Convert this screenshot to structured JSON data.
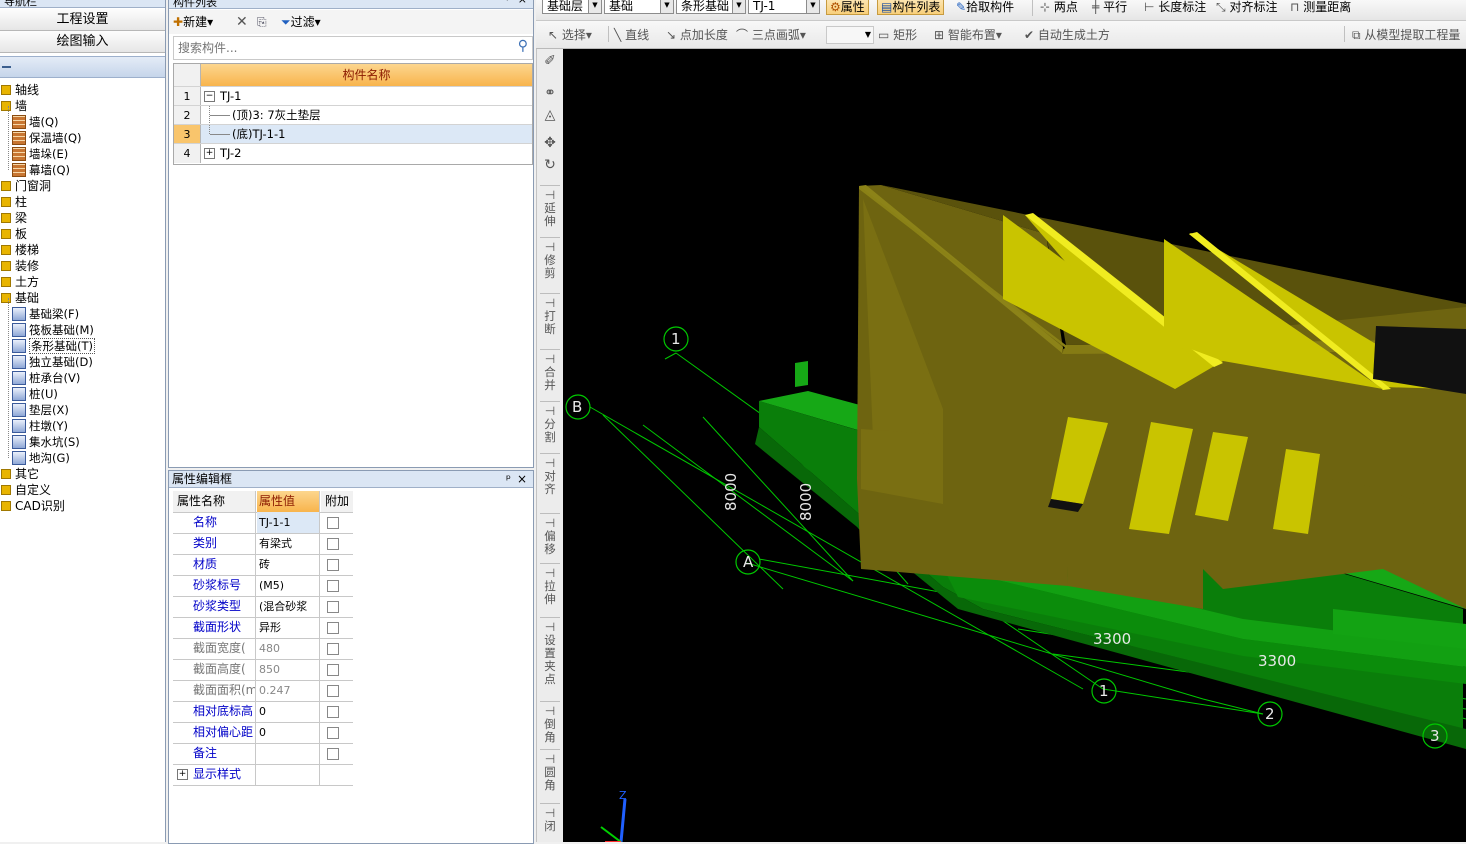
{
  "nav": {
    "title": "导航栏",
    "pin": "ᵖ",
    "close": "×",
    "buttons": [
      "工程设置",
      "绘图输入"
    ],
    "tree": [
      {
        "label": "轴线",
        "type": "folder"
      },
      {
        "label": "墙",
        "type": "folder-open"
      },
      {
        "label": "墙(Q)",
        "type": "child"
      },
      {
        "label": "保温墙(Q)",
        "type": "child"
      },
      {
        "label": "墙垛(E)",
        "type": "child"
      },
      {
        "label": "幕墙(Q)",
        "type": "child"
      },
      {
        "label": "门窗洞",
        "type": "folder"
      },
      {
        "label": "柱",
        "type": "folder"
      },
      {
        "label": "梁",
        "type": "folder"
      },
      {
        "label": "板",
        "type": "folder"
      },
      {
        "label": "楼梯",
        "type": "folder"
      },
      {
        "label": "装修",
        "type": "folder"
      },
      {
        "label": "土方",
        "type": "folder"
      },
      {
        "label": "基础",
        "type": "folder-open"
      },
      {
        "label": "基础梁(F)",
        "type": "child"
      },
      {
        "label": "筏板基础(M)",
        "type": "child"
      },
      {
        "label": "条形基础(T)",
        "type": "child-selected"
      },
      {
        "label": "独立基础(D)",
        "type": "child"
      },
      {
        "label": "桩承台(V)",
        "type": "child"
      },
      {
        "label": "桩(U)",
        "type": "child"
      },
      {
        "label": "垫层(X)",
        "type": "child"
      },
      {
        "label": "柱墩(Y)",
        "type": "child"
      },
      {
        "label": "集水坑(S)",
        "type": "child"
      },
      {
        "label": "地沟(G)",
        "type": "child"
      },
      {
        "label": "其它",
        "type": "folder"
      },
      {
        "label": "自定义",
        "type": "folder"
      },
      {
        "label": "CAD识别",
        "type": "folder"
      }
    ]
  },
  "complist": {
    "title": "构件列表",
    "toolbar": {
      "new": "新建",
      "filter": "过滤"
    },
    "search_placeholder": "搜索构件...",
    "header": "构件名称",
    "rows": [
      {
        "num": "1",
        "label": "TJ-1",
        "expander": "−"
      },
      {
        "num": "2",
        "label": "(顶)3: 7灰土垫层",
        "expander": ""
      },
      {
        "num": "3",
        "label": "(底)TJ-1-1",
        "expander": ""
      },
      {
        "num": "4",
        "label": "TJ-2",
        "expander": "+"
      }
    ]
  },
  "props": {
    "title": "属性编辑框",
    "headers": {
      "name": "属性名称",
      "value": "属性值",
      "extra": "附加"
    },
    "rows": [
      {
        "name": "名称",
        "value": "TJ-1-1",
        "gray": false
      },
      {
        "name": "类别",
        "value": "有梁式",
        "gray": false
      },
      {
        "name": "材质",
        "value": "砖",
        "gray": false
      },
      {
        "name": "砂浆标号",
        "value": "(M5)",
        "gray": false
      },
      {
        "name": "砂浆类型",
        "value": "(混合砂浆",
        "gray": false
      },
      {
        "name": "截面形状",
        "value": "异形",
        "gray": false
      },
      {
        "name": "截面宽度(",
        "value": "480",
        "gray": true
      },
      {
        "name": "截面高度(",
        "value": "850",
        "gray": true
      },
      {
        "name": "截面面积(m",
        "value": "0.247",
        "gray": true
      },
      {
        "name": "相对底标高",
        "value": "0",
        "gray": false
      },
      {
        "name": "相对偏心距",
        "value": "0",
        "gray": false
      },
      {
        "name": "备注",
        "value": "",
        "gray": false
      },
      {
        "name": "显示样式",
        "value": "",
        "gray": false
      }
    ]
  },
  "toolbar1": {
    "floor": "基础层",
    "category": "基础",
    "type": "条形基础",
    "component": "TJ-1",
    "attr_btn": "属性",
    "list_btn": "构件列表",
    "pick": "拾取构件",
    "two_point": "两点",
    "parallel": "平行",
    "length_dim": "长度标注",
    "align_dim": "对齐标注",
    "measure": "测量距离"
  },
  "toolbar2": {
    "select": "选择",
    "line": "直线",
    "point_length": "点加长度",
    "arc3": "三点画弧",
    "rect": "矩形",
    "smart": "智能布置",
    "auto_earth": "自动生成土方",
    "extract": "从模型提取工程量"
  },
  "vtoolbar": [
    "延伸",
    "修剪",
    "打断",
    "合并",
    "分割",
    "对齐",
    "偏移",
    "拉伸",
    "设置夹点",
    "倒角",
    "圆角",
    "闭"
  ],
  "viewport": {
    "axis_labels": [
      "1",
      "B",
      "A",
      "1",
      "2",
      "3"
    ],
    "dims": [
      "8000",
      "8000",
      "3300",
      "3300"
    ],
    "z_label": "Z"
  },
  "colors": {
    "wall": "#6e6410",
    "wall_dark": "#4d4608",
    "opening": "#c9c400",
    "footing": "#0c8a0c",
    "grid_line": "#00c800"
  }
}
